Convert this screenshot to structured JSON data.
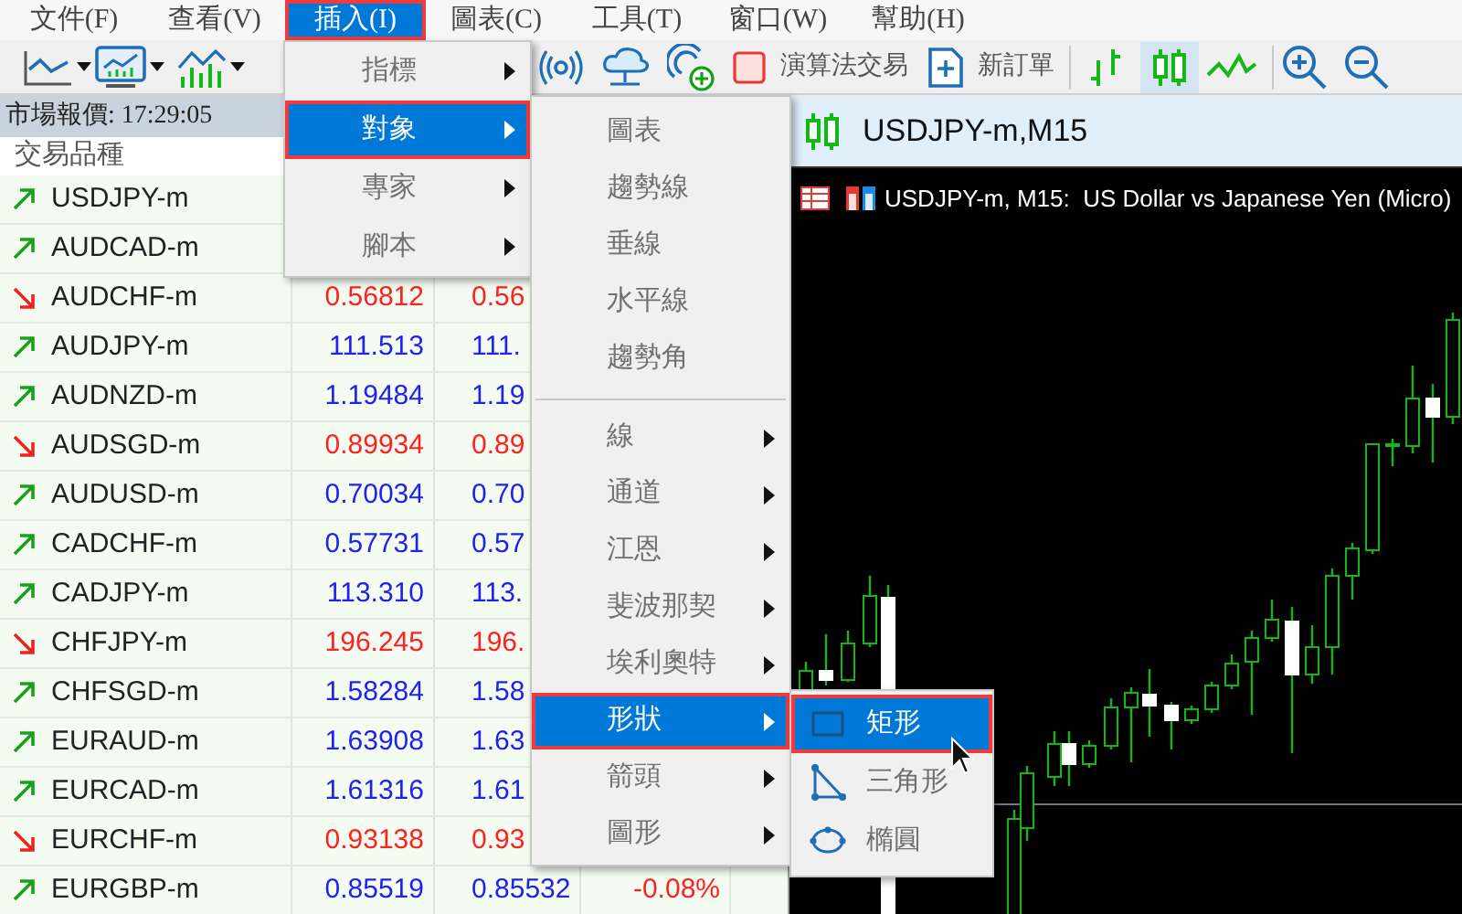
{
  "menu_bar": [
    {
      "label": "文件(F)",
      "selected": false
    },
    {
      "label": "查看(V)",
      "selected": false
    },
    {
      "label": "插入(I)",
      "selected": true
    },
    {
      "label": "圖表(C)",
      "selected": false
    },
    {
      "label": "工具(T)",
      "selected": false
    },
    {
      "label": "窗口(W)",
      "selected": false
    },
    {
      "label": "幫助(H)",
      "selected": false
    }
  ],
  "toolbar": {
    "algo_trading": "演算法交易",
    "new_order": "新訂單",
    "chart_types": [
      {
        "kind": "bars",
        "selected": false
      },
      {
        "kind": "candles",
        "selected": true
      },
      {
        "kind": "line",
        "selected": false
      }
    ]
  },
  "market_watch": {
    "title": "市場報價: 17:29:05",
    "column_1": "交易品種",
    "rows": [
      {
        "symbol": "USDJPY-m",
        "kind": "up"
      },
      {
        "symbol": "AUDCAD-m",
        "kind": "up"
      },
      {
        "symbol": "AUDCHF-m",
        "kind": "down",
        "bid": "0.56812",
        "ask": "0.56"
      },
      {
        "symbol": "AUDJPY-m",
        "kind": "up",
        "bid": "111.513",
        "ask": "111."
      },
      {
        "symbol": "AUDNZD-m",
        "kind": "up",
        "bid": "1.19484",
        "ask": "1.19"
      },
      {
        "symbol": "AUDSGD-m",
        "kind": "down",
        "bid": "0.89934",
        "ask": "0.89"
      },
      {
        "symbol": "AUDUSD-m",
        "kind": "up",
        "bid": "0.70034",
        "ask": "0.70"
      },
      {
        "symbol": "CADCHF-m",
        "kind": "up",
        "bid": "0.57731",
        "ask": "0.57"
      },
      {
        "symbol": "CADJPY-m",
        "kind": "up",
        "bid": "113.310",
        "ask": "113."
      },
      {
        "symbol": "CHFJPY-m",
        "kind": "down",
        "bid": "196.245",
        "ask": "196."
      },
      {
        "symbol": "CHFSGD-m",
        "kind": "up",
        "bid": "1.58284",
        "ask": "1.58"
      },
      {
        "symbol": "EURAUD-m",
        "kind": "up",
        "bid": "1.63908",
        "ask": "1.63"
      },
      {
        "symbol": "EURCAD-m",
        "kind": "up",
        "bid": "1.61316",
        "ask": "1.61"
      },
      {
        "symbol": "EURCHF-m",
        "kind": "down",
        "bid": "0.93138",
        "ask": "0.93"
      },
      {
        "symbol": "EURGBP-m",
        "kind": "up",
        "bid": "0.85519",
        "ask": "0.85532",
        "change": "-0.08%"
      }
    ]
  },
  "chart": {
    "tab": "USDJPY-m,M15",
    "caption": "USDJPY-m, M15:  US Dollar vs Japanese Yen (Micro)"
  },
  "menus": [
    {
      "items": [
        {
          "label": "指標",
          "kind": "submenu",
          "selected": false
        },
        {
          "label": "對象",
          "kind": "submenu",
          "selected": true
        },
        {
          "label": "專家",
          "kind": "submenu",
          "selected": false
        },
        {
          "label": "腳本",
          "kind": "submenu",
          "selected": false
        }
      ]
    },
    {
      "items": [
        {
          "label": "圖表",
          "kind": "object",
          "selected": false
        },
        {
          "label": "趨勢線",
          "kind": "object",
          "selected": false
        },
        {
          "label": "垂線",
          "kind": "object",
          "selected": false
        },
        {
          "label": "水平線",
          "kind": "object",
          "selected": false
        },
        {
          "label": "趨勢角",
          "kind": "object",
          "selected": false
        },
        {
          "label": "線",
          "kind": "submenu",
          "selected": false
        },
        {
          "label": "通道",
          "kind": "submenu",
          "selected": false
        },
        {
          "label": "江恩",
          "kind": "submenu",
          "selected": false
        },
        {
          "label": "斐波那契",
          "kind": "submenu",
          "selected": false
        },
        {
          "label": "埃利奧特",
          "kind": "submenu",
          "selected": false
        },
        {
          "label": "形狀",
          "kind": "submenu",
          "selected": true
        },
        {
          "label": "箭頭",
          "kind": "submenu",
          "selected": false
        },
        {
          "label": "圖形",
          "kind": "submenu",
          "selected": false
        }
      ]
    },
    {
      "items": [
        {
          "label": "矩形",
          "kind": "object",
          "selected": true
        },
        {
          "label": "三角形",
          "kind": "object",
          "selected": false
        },
        {
          "label": "橢圓",
          "kind": "object",
          "selected": false
        }
      ]
    }
  ]
}
